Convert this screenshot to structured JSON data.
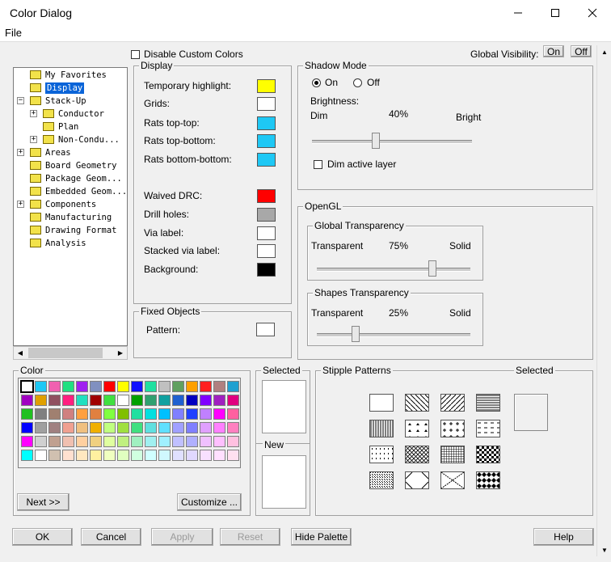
{
  "window": {
    "title": "Color Dialog",
    "menu": [
      "File"
    ]
  },
  "top": {
    "disable_custom_colors": "Disable Custom Colors",
    "global_visibility": "Global Visibility:",
    "on": "On",
    "off": "Off"
  },
  "tree": {
    "items": [
      {
        "label": "My Favorites",
        "level": 1,
        "exp": ""
      },
      {
        "label": "Display",
        "level": 1,
        "exp": "",
        "selected": true
      },
      {
        "label": "Stack-Up",
        "level": 1,
        "exp": "-",
        "open": true
      },
      {
        "label": "Conductor",
        "level": 2,
        "exp": "+"
      },
      {
        "label": "Plan",
        "level": 2,
        "exp": ""
      },
      {
        "label": "Non-Condu...",
        "level": 2,
        "exp": "+"
      },
      {
        "label": "Areas",
        "level": 1,
        "exp": "+"
      },
      {
        "label": "Board Geometry",
        "level": 1,
        "exp": ""
      },
      {
        "label": "Package Geom...",
        "level": 1,
        "exp": ""
      },
      {
        "label": "Embedded Geom...",
        "level": 1,
        "exp": ""
      },
      {
        "label": "Components",
        "level": 1,
        "exp": "+"
      },
      {
        "label": "Manufacturing",
        "level": 1,
        "exp": ""
      },
      {
        "label": "Drawing Format",
        "level": 1,
        "exp": ""
      },
      {
        "label": "Analysis",
        "level": 1,
        "exp": ""
      }
    ]
  },
  "display": {
    "title": "Display",
    "items": [
      {
        "label": "Temporary highlight:",
        "color": "#ffff00"
      },
      {
        "label": "Grids:",
        "color": "#ffffff"
      },
      {
        "label": "Rats top-top:",
        "color": "#1ec8f5"
      },
      {
        "label": "Rats top-bottom:",
        "color": "#1ec8f5"
      },
      {
        "label": "Rats bottom-bottom:",
        "color": "#1ec8f5"
      },
      {
        "label": "Waived DRC:",
        "color": "#ff0000"
      },
      {
        "label": "Drill holes:",
        "color": "#a8a8a8"
      },
      {
        "label": "Via label:",
        "color": "#ffffff"
      },
      {
        "label": "Stacked via label:",
        "color": "#ffffff"
      },
      {
        "label": "Background:",
        "color": "#000000"
      }
    ]
  },
  "fixed": {
    "title": "Fixed Objects",
    "pattern": "Pattern:",
    "pattern_color": "#ffffff"
  },
  "shadow": {
    "title": "Shadow Mode",
    "on": "On",
    "off": "Off",
    "brightness": "Brightness:",
    "dim": "Dim",
    "pct": "40%",
    "bright": "Bright",
    "level": 0.4,
    "dim_active": "Dim active layer"
  },
  "opengl": {
    "title": "OpenGL",
    "global": {
      "title": "Global Transparency",
      "left": "Transparent",
      "pct": "75%",
      "right": "Solid",
      "level": 0.75
    },
    "shapes": {
      "title": "Shapes Transparency",
      "left": "Transparent",
      "pct": "25%",
      "right": "Solid",
      "level": 0.25
    }
  },
  "color": {
    "title": "Color",
    "next": "Next >>",
    "customize": "Customize ...",
    "rows": [
      [
        "#ffffff",
        "#1ec8f5",
        "#f060b0",
        "#20e080",
        "#a020f0",
        "#8090c0",
        "#ff0000",
        "#ffff00",
        "#1010ff",
        "#20e0a0",
        "#c0c0c0",
        "#60a060",
        "#ffa000",
        "#ff2020",
        "#b08080",
        "#20a0d0"
      ],
      [
        "#a000c0",
        "#e0a000",
        "#905060",
        "#ff2080",
        "#20e0c0",
        "#a00000",
        "#40e040",
        "#ffffff",
        "#00a000",
        "#30a070",
        "#10a0a0",
        "#2060d0",
        "#0000c0",
        "#8000ff",
        "#a020c0",
        "#e00080"
      ],
      [
        "#20c020",
        "#808080",
        "#a08070",
        "#d08080",
        "#ffa040",
        "#e08040",
        "#80ff40",
        "#80c000",
        "#20e0a0",
        "#00e0e0",
        "#00c0ff",
        "#8080ff",
        "#2040ff",
        "#c080ff",
        "#ff00ff",
        "#ff60a0"
      ],
      [
        "#0000ff",
        "#a0a0a0",
        "#a08080",
        "#f0a090",
        "#f0c080",
        "#f0b000",
        "#c0ff80",
        "#a0e040",
        "#40e080",
        "#60e0e0",
        "#60e0ff",
        "#a0a0ff",
        "#8080ff",
        "#e0a0ff",
        "#ff80ff",
        "#ff80c0"
      ],
      [
        "#ff00ff",
        "#d0d0d0",
        "#c0a090",
        "#f0c0b0",
        "#ffd0a0",
        "#f0d080",
        "#e0ffa0",
        "#c0f080",
        "#a0f0c0",
        "#a0f0f0",
        "#a0f0ff",
        "#c0c0ff",
        "#b0b0ff",
        "#f0c0ff",
        "#ffc0ff",
        "#ffc0e0"
      ],
      [
        "#00ffff",
        "#ffffff",
        "#d0c0b0",
        "#ffe0d0",
        "#ffe8c0",
        "#fff0a0",
        "#f0ffc0",
        "#e0ffc0",
        "#d0ffe0",
        "#d0ffff",
        "#d0f8ff",
        "#e0e0ff",
        "#e0d8ff",
        "#f8e0ff",
        "#ffe0ff",
        "#ffe0f0"
      ]
    ]
  },
  "selected_panel": {
    "selected": "Selected",
    "new": "New"
  },
  "stipple": {
    "title": "Stipple Patterns",
    "selected": "Selected"
  },
  "buttons": {
    "ok": "OK",
    "cancel": "Cancel",
    "apply": "Apply",
    "reset": "Reset",
    "hide": "Hide Palette",
    "help": "Help"
  }
}
